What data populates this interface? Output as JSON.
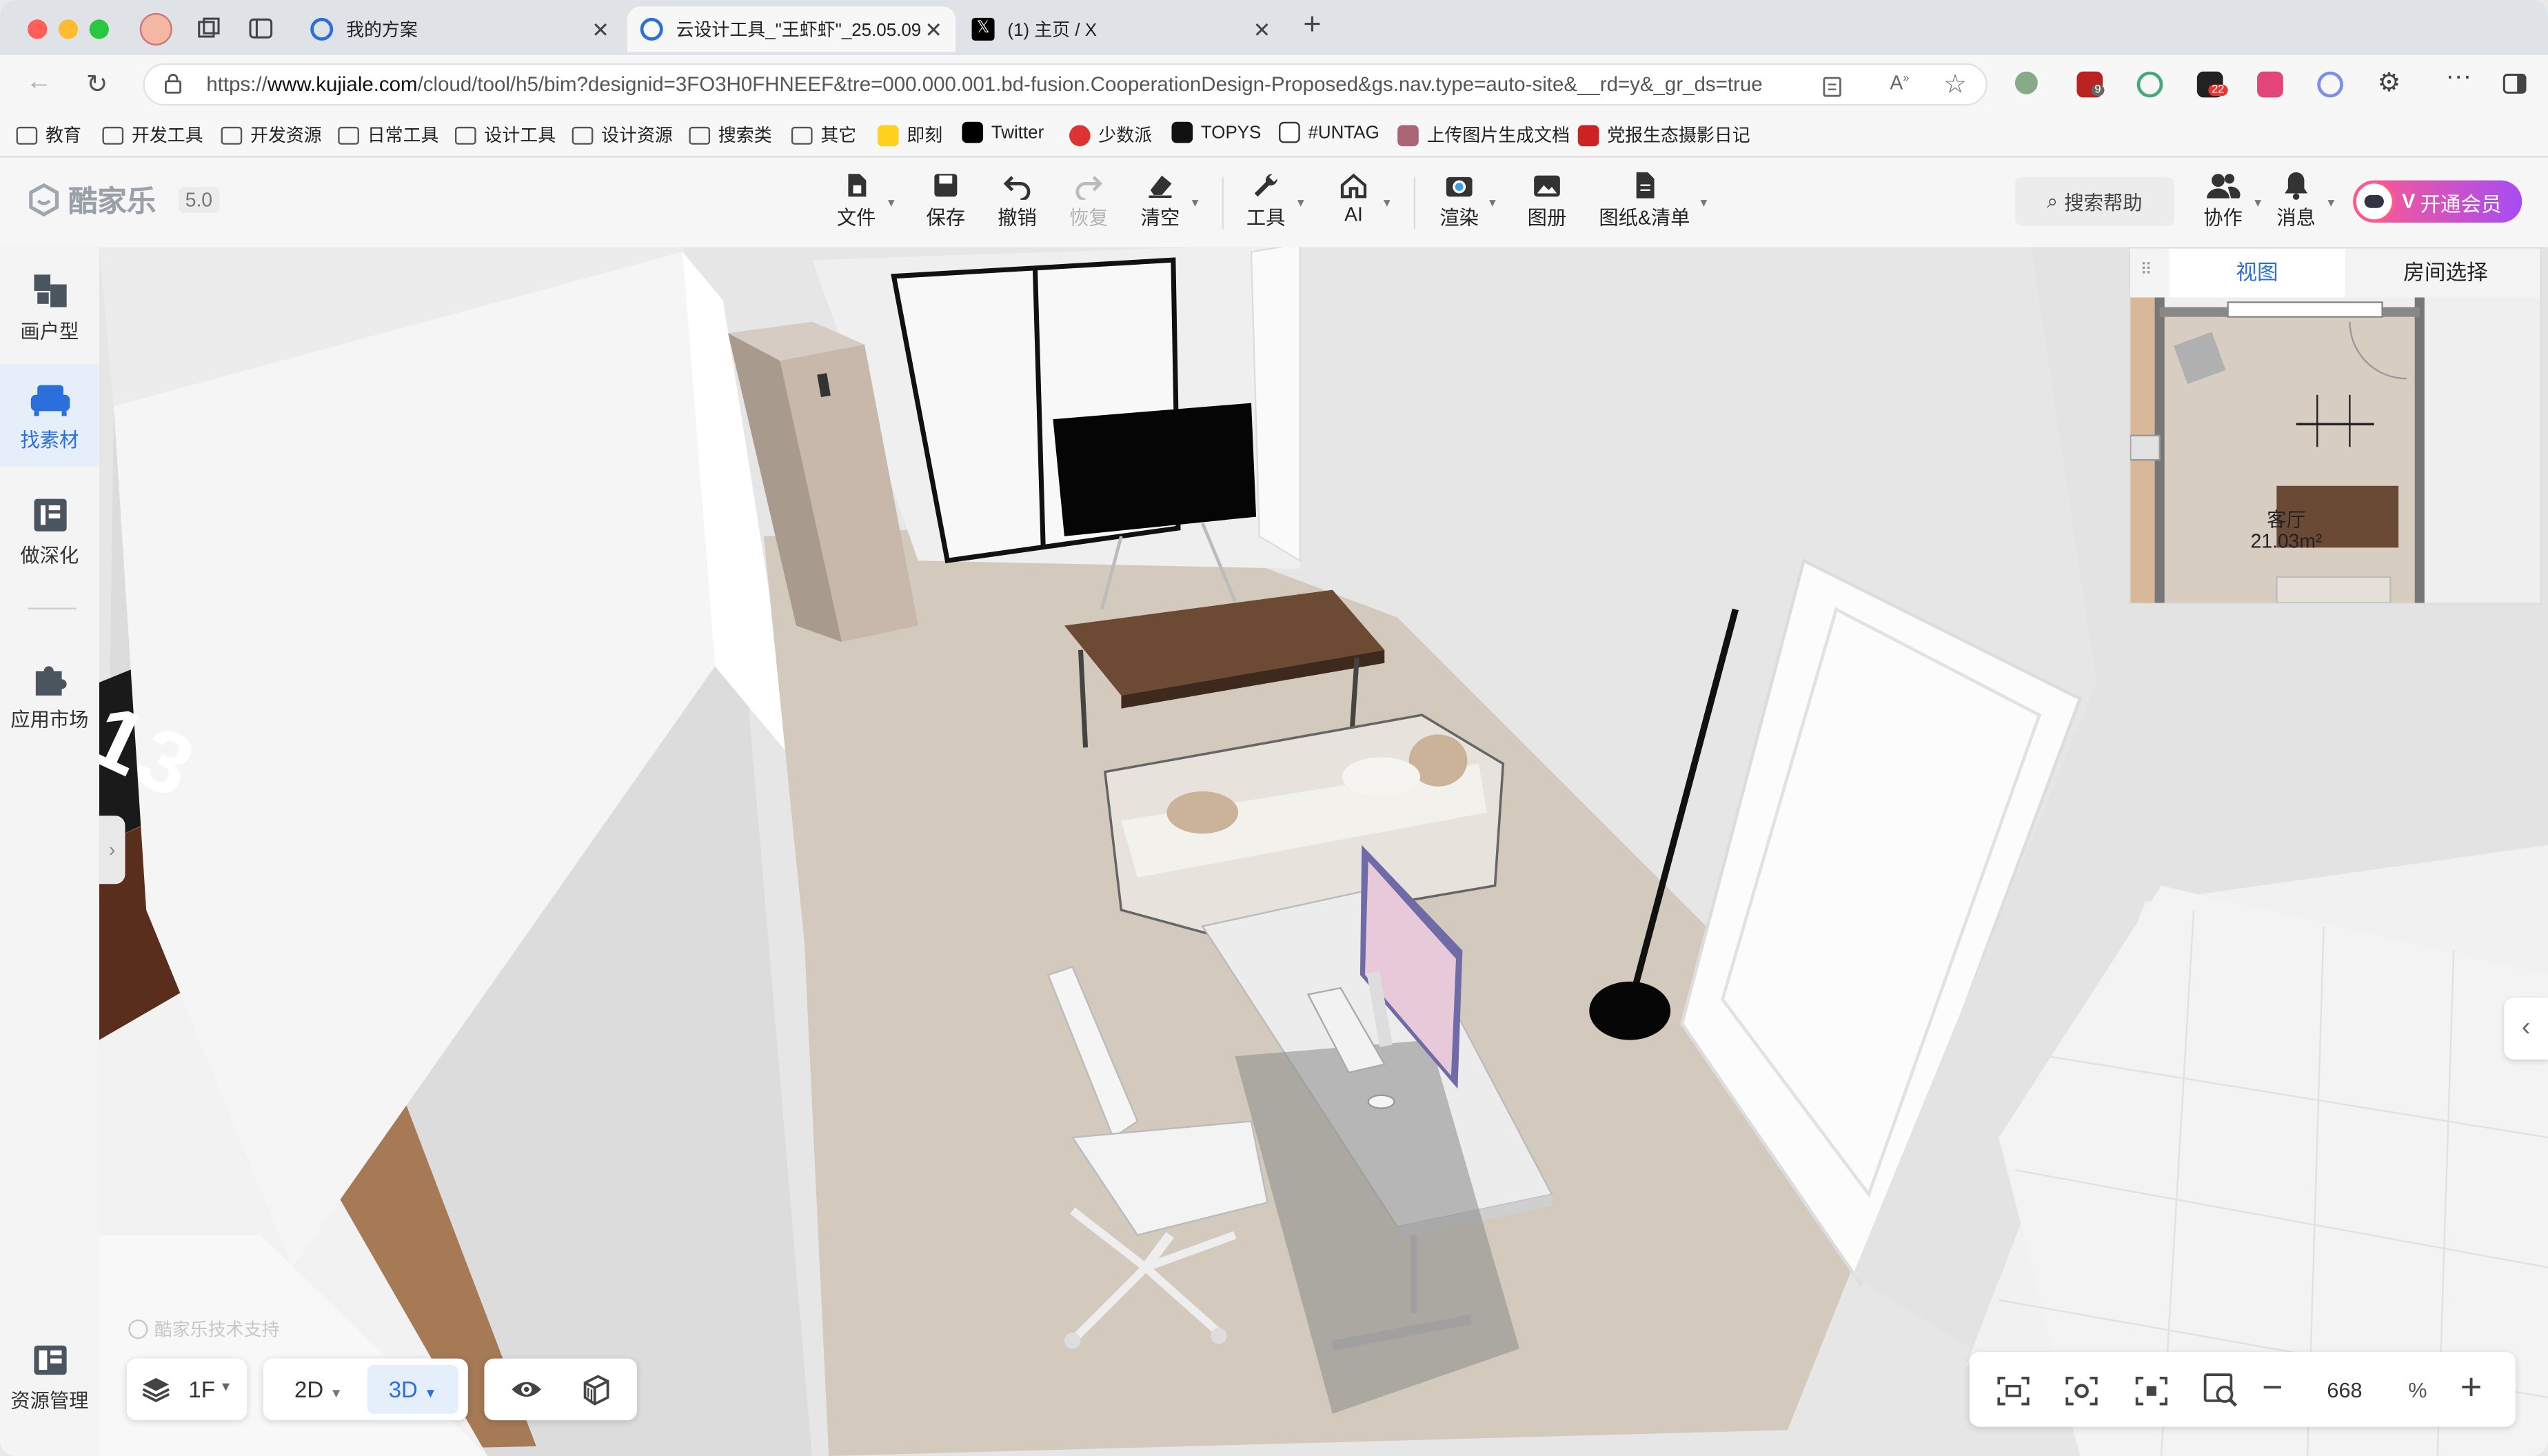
{
  "browser": {
    "tabs": [
      {
        "title": "我的方案"
      },
      {
        "title": "云设计工具_\"王虾虾\"_25.05.09"
      },
      {
        "title": "(1) 主页 / X"
      }
    ],
    "new_tab_symbol": "+",
    "url_prefix": "https://",
    "url_host": "www.kujiale.com",
    "url_path": "/cloud/tool/h5/bim?designid=3FO3H0FHNEEF&tre=000.000.001.bd-fusion.CooperationDesign-Proposed&gs.nav.type=auto-site&__rd=y&_gr_ds=true",
    "extension_badges": [
      "9",
      "22"
    ],
    "bookmarks": [
      "教育",
      "开发工具",
      "开发资源",
      "日常工具",
      "设计工具",
      "设计资源",
      "搜索类",
      "其它",
      "即刻",
      "Twitter",
      "少数派",
      "TOPYS",
      "#UNTAG",
      "上传图片生成文档",
      "党报生态摄影日记"
    ]
  },
  "app": {
    "logo_text": "酷家乐",
    "version": "5.0",
    "toolbar": {
      "file": "文件",
      "save": "保存",
      "undo": "撤销",
      "redo": "恢复",
      "clear": "清空",
      "tools": "工具",
      "ai": "AI",
      "render": "渲染",
      "album": "图册",
      "drawings": "图纸&清单"
    },
    "search_help": "搜索帮助",
    "collaborate": "协作",
    "messages": "消息",
    "vip_label": "开通会员",
    "vip_v": "V"
  },
  "sidebar": {
    "items": [
      {
        "label": "画户型"
      },
      {
        "label": "找素材"
      },
      {
        "label": "做深化"
      },
      {
        "label": "应用市场"
      },
      {
        "label": "资源管理"
      }
    ]
  },
  "minimap": {
    "tab_view": "视图",
    "tab_room": "房间选择",
    "room_name": "客厅",
    "room_area": "21.03m²"
  },
  "viewport": {
    "support_text": "酷家乐技术支持",
    "floor_number": "13"
  },
  "bottombar": {
    "floor": "1F",
    "mode_2d": "2D",
    "mode_3d": "3D",
    "zoom_value": "668",
    "zoom_unit": "%"
  },
  "colors": {
    "accent": "#2a6fdb",
    "vip_start": "#ff5a8a",
    "vip_end": "#a64cf5"
  }
}
